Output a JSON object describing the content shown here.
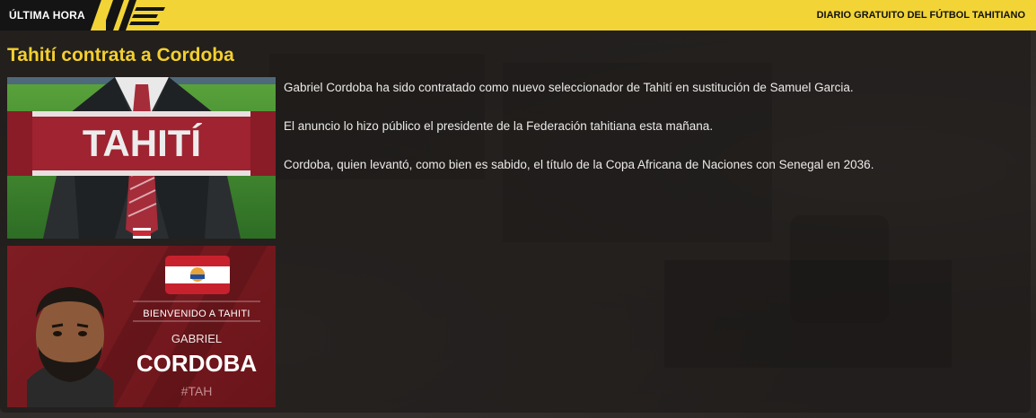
{
  "topbar": {
    "tag": "ÚLTIMA HORA",
    "masthead": "DIARIO GRATUITO DEL FÚTBOL TAHITIANO"
  },
  "article": {
    "headline": "Tahití contrata a Cordoba",
    "paragraphs": [
      "Gabriel Cordoba ha sido contratado como nuevo seleccionador de Tahití en sustitución de Samuel Garcia.",
      "El anuncio lo hizo público el presidente de la Federación tahitiana esta mañana.",
      "Cordoba, quien levantó, como bien es sabido, el título de la Copa Africana de Naciones con Senegal en 2036."
    ]
  },
  "scarf_image": {
    "scarf_text": "TAHITÍ"
  },
  "welcome_card": {
    "banner": "BIENVENIDO A TAHITI",
    "first_name": "GABRIEL",
    "last_name": "CORDOBA",
    "hashtag": "#TAH"
  },
  "colors": {
    "accent": "#f2d437",
    "headline": "#f3cf2f",
    "card_red": "#7e1d23"
  }
}
